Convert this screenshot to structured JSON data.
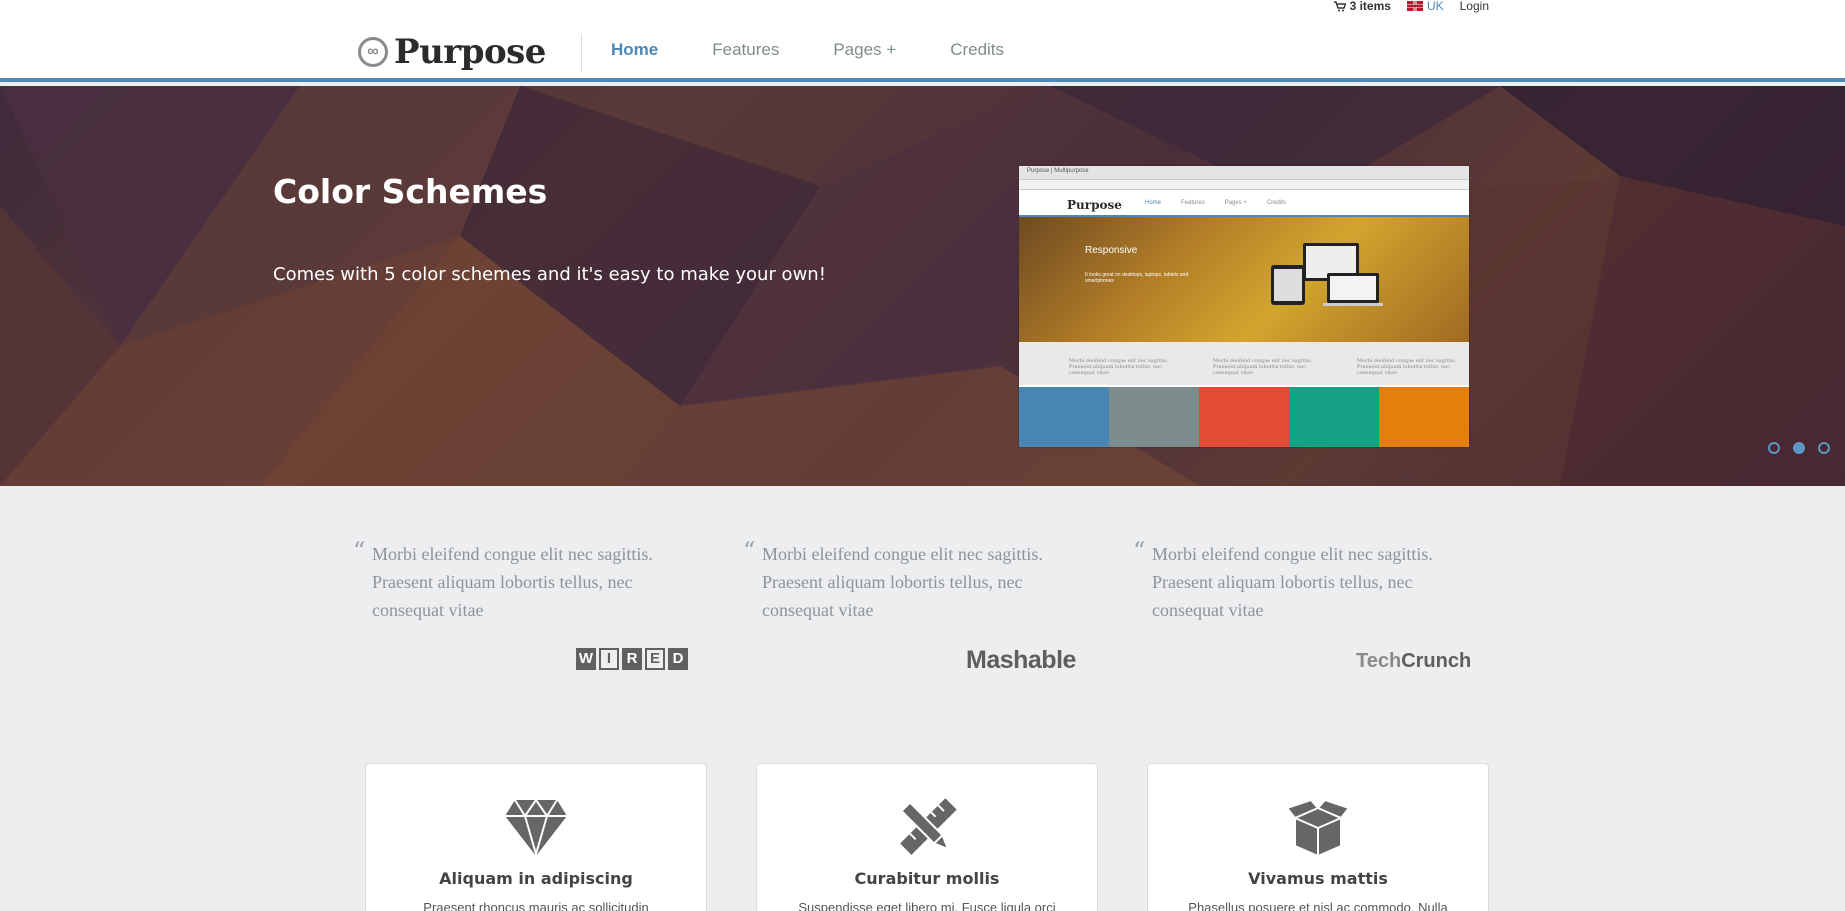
{
  "utility": {
    "cart": "3 items",
    "region": "UK",
    "login": "Login"
  },
  "brand": {
    "name": "Purpose"
  },
  "nav": [
    "Home",
    "Features",
    "Pages +",
    "Credits"
  ],
  "hero": {
    "title": "Color Schemes",
    "subtitle": "Comes with 5 color schemes and it's easy to make your own!",
    "slide_count": 3,
    "active_slide": 2
  },
  "preview": {
    "tab": "Purpose | Multipurpose",
    "brand": "Purpose",
    "nav": [
      "Home",
      "Features",
      "Pages +",
      "Credits"
    ],
    "hero_title": "Responsive",
    "hero_text": "It looks great on desktops, laptops, tablets and smartphones",
    "quotes": [
      "Morbi eleifend congue elit nec sagittis. Praesent aliquam lobortis tellus, nec consequat vitae",
      "Morbi eleifend congue elit nec sagittis. Praesent aliquam lobortis tellus, nec consequat vitae",
      "Morbi eleifend congue elit nec sagittis. Praesent aliquam lobortis tellus, nec consequat vitae"
    ],
    "swatches": [
      "#4a86b4",
      "#7f8c8d",
      "#e34b35",
      "#16a085",
      "#e67e0d"
    ]
  },
  "testimonials": [
    {
      "text": "Morbi eleifend congue elit nec sagittis. Praesent aliquam lobortis tellus, nec consequat vitae",
      "brand": "WIRED"
    },
    {
      "text": "Morbi eleifend congue elit nec sagittis. Praesent aliquam lobortis tellus, nec consequat vitae",
      "brand": "Mashable"
    },
    {
      "text": "Morbi eleifend congue elit nec sagittis. Praesent aliquam lobortis tellus, nec consequat vitae",
      "brand_a": "Tech",
      "brand_b": "Crunch"
    }
  ],
  "features": [
    {
      "icon": "diamond-icon",
      "title": "Aliquam in adipiscing",
      "text": "Praesent rhoncus mauris ac sollicitudin"
    },
    {
      "icon": "pencil-ruler-icon",
      "title": "Curabitur mollis",
      "text": "Suspendisse eget libero mi. Fusce ligula orci"
    },
    {
      "icon": "box-icon",
      "title": "Vivamus mattis",
      "text": "Phasellus posuere et nisl ac commodo. Nulla"
    }
  ],
  "colors": {
    "accent": "#4d87b5",
    "text_muted": "#7f8c8d"
  }
}
